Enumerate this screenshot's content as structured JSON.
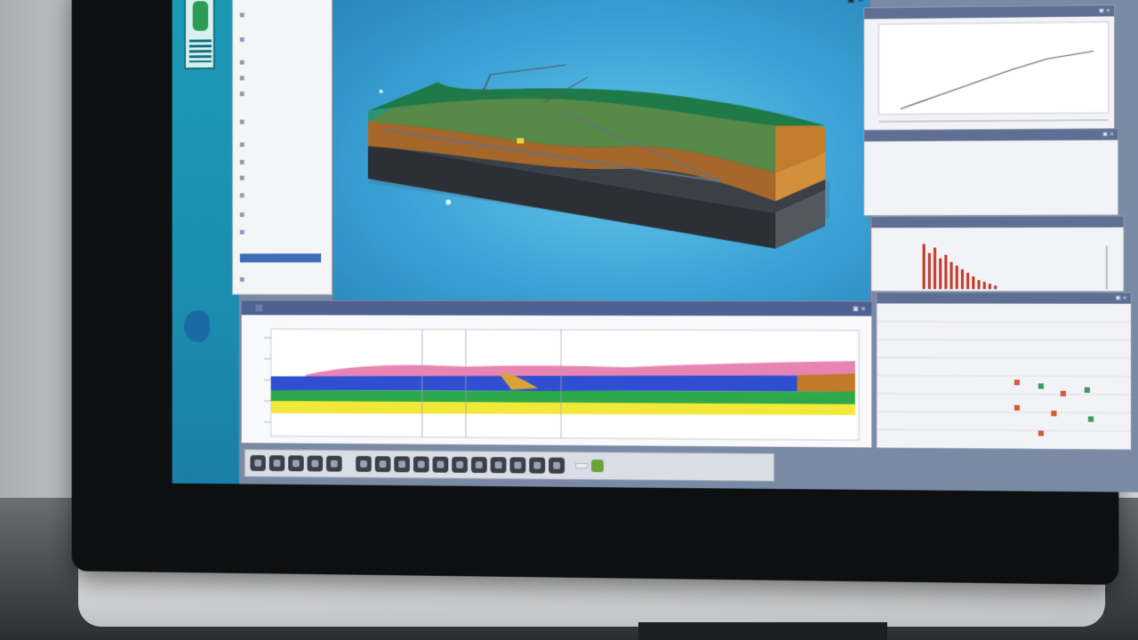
{
  "titlebar": {
    "tabs": [
      "",
      "",
      ""
    ]
  },
  "viewport": {
    "controls": "▣ ×"
  },
  "left_strip": {
    "items": [
      {
        "label": "",
        "tone": "normal"
      },
      {
        "label": "",
        "tone": "normal"
      },
      {
        "label": "",
        "tone": "normal"
      },
      {
        "label": "",
        "tone": "red"
      },
      {
        "label": "",
        "tone": "red"
      },
      {
        "label": "",
        "tone": "red"
      }
    ]
  },
  "tree": {
    "header": "",
    "selected": ""
  },
  "line_panel": {
    "header": "",
    "controls": "▣ ×"
  },
  "props_panel": {
    "header": "",
    "controls": "▣ ×"
  },
  "hist_panel": {
    "header": ""
  },
  "table_panel": {
    "header": "",
    "controls": "▣ ×"
  },
  "section_panel": {
    "header": "",
    "tab": "",
    "title": "",
    "controls": "▣ ×"
  },
  "toolbar": {
    "label": ""
  },
  "colors": {
    "accent": "#1c9bb5",
    "panel_header": "#5f6f93",
    "section_header": "#4f6190",
    "terrain_green": "#1f7a4a",
    "terrain_orange": "#c07a2a",
    "strata_blue": "#2f4fd0",
    "strata_yellow": "#f1e83a",
    "strata_pink": "#e884b4"
  },
  "icons": [
    "app-logo-icon",
    "folder-icon",
    "toolbar-tool-icon",
    "close-icon",
    "maximize-icon"
  ]
}
